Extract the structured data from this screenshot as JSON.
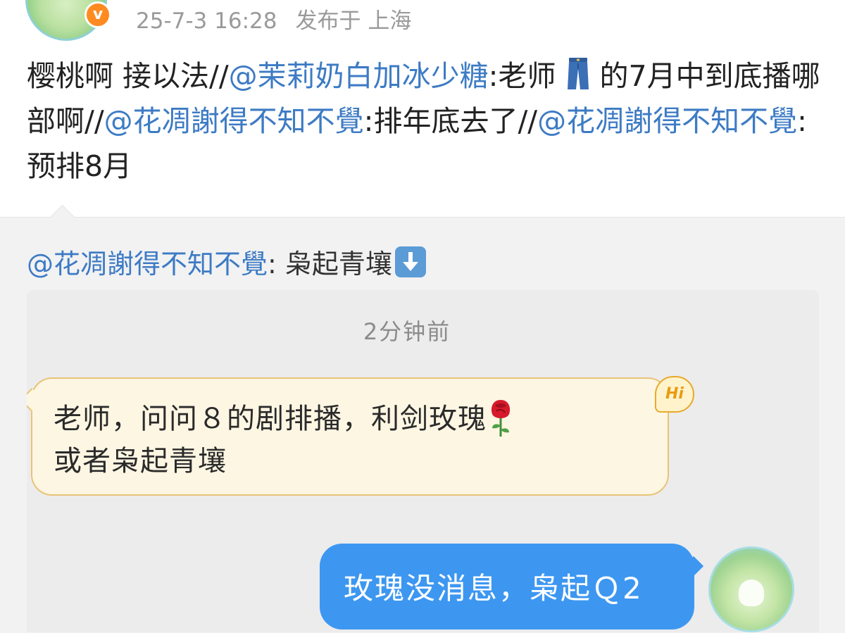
{
  "header": {
    "timestamp": "25-7-3 16:28",
    "location": "发布于 上海",
    "vip_badge": "v"
  },
  "post": {
    "seg1": "樱桃啊 接以法//",
    "mention1": "@茉莉奶白加冰少糖",
    "seg2": ":老师",
    "seg3": "的7月中到底播哪部啊//",
    "mention2": "@花凋謝得不知不覺",
    "seg4": ":排年底去了//",
    "mention3": "@花凋謝得不知不覺",
    "seg5": ":预排8月"
  },
  "quote": {
    "mention": "@花凋謝得不知不覺",
    "text": ": 枭起青壤",
    "arrow_icon": "down-arrow-icon"
  },
  "chat": {
    "time": "2分钟前",
    "left_line1": "老师，问问８的剧排播，利剑玫瑰",
    "left_line2": "或者枭起青壤",
    "hi_badge": "Hi",
    "right_text": "玫瑰没消息，枭起Ｑ2"
  },
  "colors": {
    "mention": "#3d7bc4",
    "right_bubble": "#3d97f1",
    "left_bubble": "#fdf6e3",
    "vip": "#ff8a1f"
  }
}
